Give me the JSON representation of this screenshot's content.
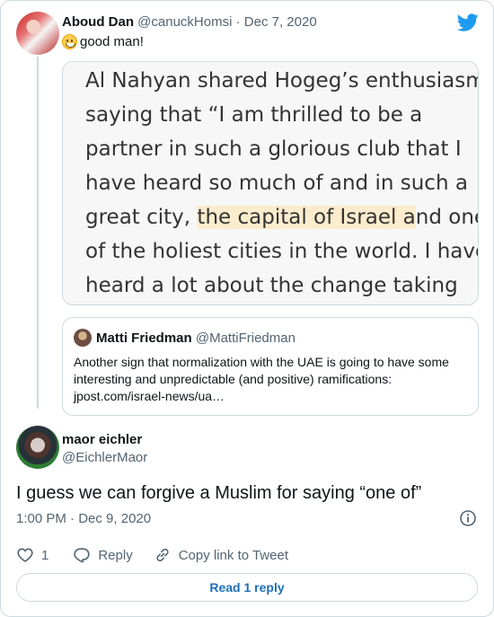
{
  "parent_tweet": {
    "author_name": "Aboud Dan",
    "handle": "@canuckHomsi",
    "separator": "·",
    "date": "Dec 7, 2020",
    "text": "good man!",
    "emoji": "grinning-face-emoji",
    "image_lines": [
      "Al Nahyan shared Hogeg’s enthusiasm,",
      "saying that “I am thrilled to be a",
      "partner in such a glorious club that I",
      "have heard so much of and in such a",
      "great city, ",
      "of the holiest cities in the world. I have",
      "heard a lot about the change taking"
    ],
    "image_highlight": "the capital of Israel a",
    "image_line5_tail": "nd one",
    "quoted_tweet": {
      "author_name": "Matti Friedman",
      "handle": "@MattiFriedman",
      "text": "Another sign that normalization with the UAE is going to have some interesting and unpredictable (and positive) ramifications: jpost.com/israel-news/ua…"
    }
  },
  "reply_tweet": {
    "author_name": "maor eichler",
    "handle": "@EichlerMaor",
    "text": "I guess we can forgive a Muslim for saying “one of”",
    "time": "1:00 PM",
    "separator": "·",
    "date": "Dec 9, 2020",
    "like_count": "1",
    "reply_label": "Reply",
    "copy_link_label": "Copy link to Tweet",
    "read_replies_label": "Read 1 reply"
  },
  "colors": {
    "brand": "#1d9bf0",
    "text": "#0f1419",
    "muted": "#536471",
    "border": "#cfd9de",
    "highlight": "#fbeccd",
    "link": "#1d6fb8"
  },
  "icons": [
    "twitter-bird-icon",
    "info-icon",
    "heart-icon",
    "reply-icon",
    "link-icon"
  ]
}
